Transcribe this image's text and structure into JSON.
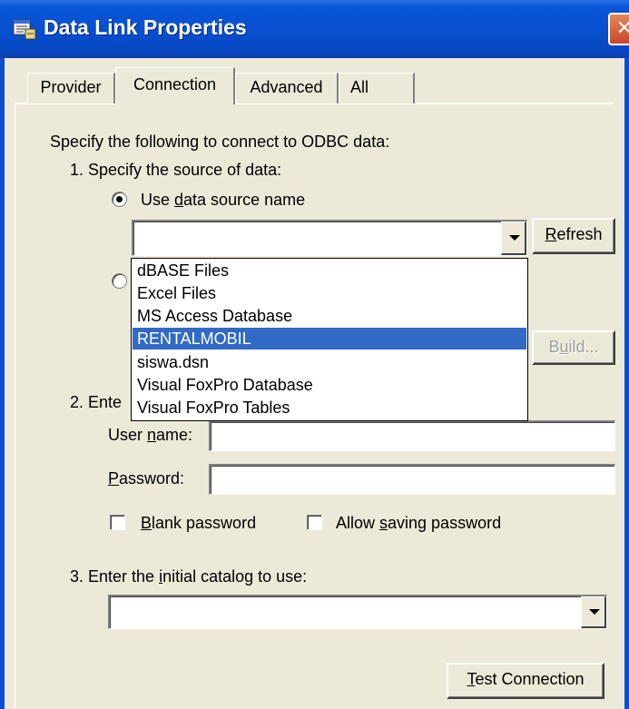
{
  "window": {
    "title": "Data Link Properties",
    "close_glyph": "✕"
  },
  "tabs": [
    {
      "label": "Provider"
    },
    {
      "label": "Connection"
    },
    {
      "label": "Advanced"
    },
    {
      "label": "All"
    }
  ],
  "connection": {
    "intro": "Specify the following to connect to ODBC data:",
    "step1": "1. Specify the source of data:",
    "use_dsn_pre": "Use ",
    "use_dsn_key": "d",
    "use_dsn_post": "ata source name",
    "dsn_value": "",
    "refresh_key": "R",
    "refresh_rest": "efresh",
    "build_pre": "B",
    "build_key": "u",
    "build_post": "ild...",
    "dsn_options": [
      "dBASE Files",
      "Excel Files",
      "MS Access Database",
      "RENTALMOBIL",
      "siswa.dsn",
      "Visual FoxPro Database",
      "Visual FoxPro Tables"
    ],
    "dsn_highlighted": "RENTALMOBIL",
    "step2_visible": "2. Ente",
    "user_name_pre": "User ",
    "user_name_key": "n",
    "user_name_post": "ame:",
    "user_name_value": "",
    "password_key": "P",
    "password_post": "assword:",
    "password_value": "",
    "blank_pw_key": "B",
    "blank_pw_post": "lank password",
    "allow_pw_pre": "Allow ",
    "allow_pw_key": "s",
    "allow_pw_post": "aving password",
    "step3_pre": "3. Enter the ",
    "step3_key": "i",
    "step3_post": "nitial catalog to use:",
    "catalog_value": "",
    "test_key": "T",
    "test_post": "est Connection"
  },
  "icons": {
    "app": "data-link-icon",
    "close": "close-icon",
    "dropdown": "chevron-down-icon"
  },
  "colors": {
    "titlebar": "#0a55d9",
    "face": "#ece9d8",
    "selection": "#316ac5",
    "close": "#c8482b"
  }
}
